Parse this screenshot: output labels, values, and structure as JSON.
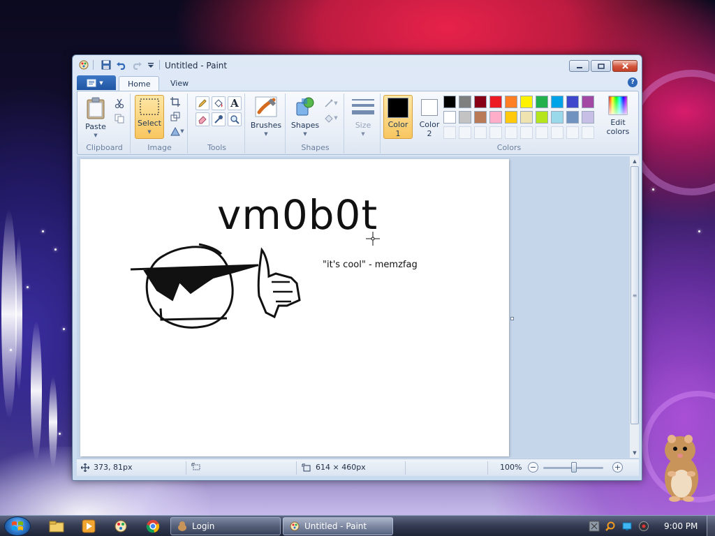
{
  "window": {
    "title": "Untitled - Paint"
  },
  "ribbon": {
    "file_menu_label": "",
    "tabs": [
      {
        "label": "Home"
      },
      {
        "label": "View"
      }
    ],
    "clipboard": {
      "paste_label": "Paste",
      "group_label": "Clipboard"
    },
    "image": {
      "select_label": "Select",
      "group_label": "Image"
    },
    "tools": {
      "group_label": "Tools"
    },
    "brushes": {
      "label": "Brushes"
    },
    "shapes": {
      "label": "Shapes",
      "group_label": "Shapes"
    },
    "size": {
      "label": "Size"
    },
    "colors": {
      "color1_label": "Color\n1",
      "color2_label": "Color\n2",
      "color1_value": "#000000",
      "color2_value": "#ffffff",
      "edit_colors_label": "Edit\ncolors",
      "group_label": "Colors",
      "palette_row1": [
        "#000000",
        "#7f7f7f",
        "#880015",
        "#ed1c24",
        "#ff7f27",
        "#fff200",
        "#22b14c",
        "#00a2e8",
        "#3f48cc",
        "#a349a4"
      ],
      "palette_row2": [
        "#ffffff",
        "#c3c3c3",
        "#b97a57",
        "#ffaec9",
        "#ffc90e",
        "#efe4b0",
        "#b5e61d",
        "#99d9ea",
        "#7092be",
        "#c8bfe7"
      ]
    }
  },
  "canvas": {
    "title_text": "vm0b0t",
    "quote_text": "\"it's cool\" - memzfag"
  },
  "statusbar": {
    "cursor_position": "373, 81px",
    "image_size": "614 × 460px",
    "zoom_level": "100%"
  },
  "taskbar": {
    "tasks": [
      {
        "label": "Login"
      },
      {
        "label": "Untitled - Paint"
      }
    ],
    "clock": "9:00 PM"
  },
  "icons": {
    "app": "paint-app-icon",
    "save": "save-icon",
    "undo": "undo-icon",
    "redo": "redo-icon",
    "help": "help-icon"
  }
}
